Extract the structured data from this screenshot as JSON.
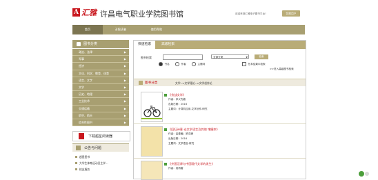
{
  "header": {
    "logo_char": "A",
    "logo_text": "汇雅",
    "library_title": "许昌电气职业学院图书馆",
    "welcome_text": "欢迎来到汇雅电子图书平台！",
    "welcome_button": "切换用户"
  },
  "nav": {
    "items": [
      {
        "label": "首页",
        "active": true
      },
      {
        "label": "권限读者",
        "active": false
      },
      {
        "label": "使用帮助",
        "active": false
      }
    ]
  },
  "sidebar": {
    "heading": "图书分类",
    "categories": [
      "政治、法律",
      "军事",
      "经济",
      "文化、科学、教育、体育",
      "语言、文字",
      "文学",
      "历史、地理",
      "工业技术",
      "交通运输",
      "航空、航天",
      "综合性图书"
    ],
    "reader_download": "下载超星阅读器",
    "notice_heading": "公告与问题",
    "notices": [
      "超星图书",
      "大学生体育运动员主学...",
      "校友服务"
    ]
  },
  "main": {
    "tabs": [
      {
        "label": "快速检索",
        "active": true
      },
      {
        "label": "高级检索",
        "active": false
      }
    ],
    "search": {
      "label": "图书检索",
      "input_value": "",
      "select_value": "全部分类",
      "button_label": "检索",
      "radios": [
        {
          "label": "书名",
          "checked": true
        },
        {
          "label": "作者",
          "checked": false
        },
        {
          "label": "主题词",
          "checked": false
        }
      ],
      "checkbox_label": "在本结果中检索",
      "advanced_link": ">>进入高级图书检索"
    },
    "crumb": {
      "title": "图书分类",
      "path": "文学-->文学理论-->文学创作论"
    },
    "books": [
      {
        "title": "《抗战文学》",
        "author_label": "作者：",
        "author": "祁义先著",
        "date_label": "出版日期：",
        "date": "2016",
        "subject_label": "主题词：",
        "subject": "计算机应用-文学创作-研究"
      },
      {
        "title": "《回归诗意 论文学语言及其他 增编本》",
        "author_label": "作者：",
        "author": "金秦著；舒洪峰",
        "date_label": "出版日期：",
        "date": "2016",
        "subject_label": "主题词：",
        "subject": "文学语言-研究"
      },
      {
        "title": "《外国汉译与中国现代文学的发生》",
        "author_label": "作者：",
        "author": "成桥著",
        "date_label": "",
        "date": "",
        "subject_label": "",
        "subject": ""
      }
    ]
  }
}
